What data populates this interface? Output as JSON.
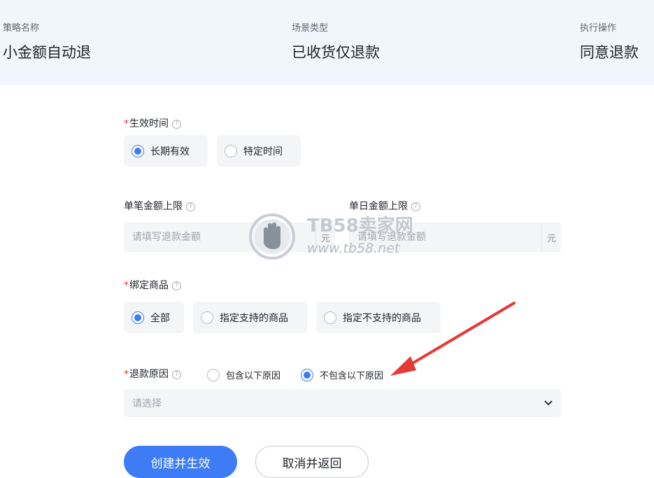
{
  "summary": {
    "strategy_label": "策略名称",
    "strategy_value": "小金额自动退",
    "scene_label": "场景类型",
    "scene_value": "已收货仅退款",
    "action_label": "执行操作",
    "action_value": "同意退款"
  },
  "effective_time": {
    "required_mark": "*",
    "label": "生效时间",
    "help": "?",
    "options": [
      {
        "label": "长期有效",
        "checked": true
      },
      {
        "label": "特定时间",
        "checked": false
      }
    ]
  },
  "single_limit": {
    "label": "单笔金额上限",
    "help": "?",
    "placeholder": "请填写退款金额",
    "unit": "元"
  },
  "daily_limit": {
    "label": "单日金额上限",
    "help": "?",
    "placeholder": "请填写退款金额",
    "unit": "元"
  },
  "bind_goods": {
    "required_mark": "*",
    "label": "绑定商品",
    "help": "?",
    "options": [
      {
        "label": "全部",
        "checked": true
      },
      {
        "label": "指定支持的商品",
        "checked": false
      },
      {
        "label": "指定不支持的商品",
        "checked": false
      }
    ]
  },
  "refund_reason": {
    "required_mark": "*",
    "label": "退款原因",
    "help": "?",
    "options": [
      {
        "label": "包含以下原因",
        "checked": false
      },
      {
        "label": "不包含以下原因",
        "checked": true
      }
    ],
    "select_placeholder": "请选择"
  },
  "actions": {
    "create_label": "创建并生效",
    "cancel_label": "取消并返回"
  },
  "watermark": {
    "brand": "TB58卖家网",
    "url": "www.tb58.net"
  },
  "colors": {
    "accent": "#3d7cf4",
    "required": "#e23a3a",
    "annotation_arrow": "#e53935"
  }
}
